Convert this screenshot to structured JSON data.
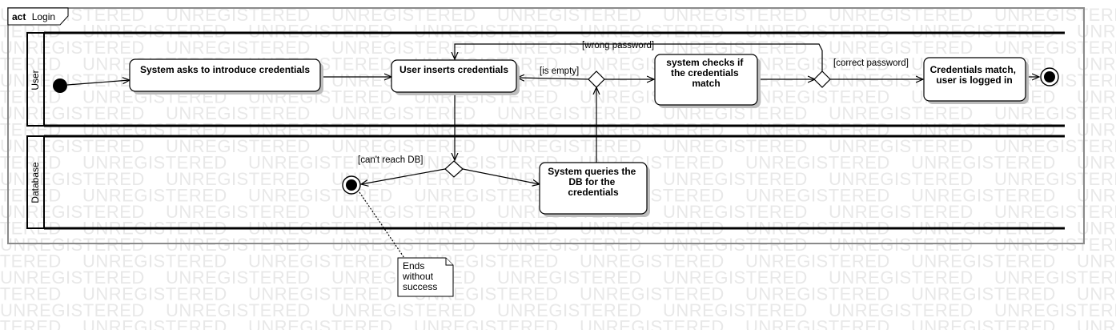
{
  "watermark": "UNREGISTERED",
  "frame": {
    "keyword": "act",
    "name": "Login"
  },
  "lanes": [
    {
      "id": "user",
      "label": "User"
    },
    {
      "id": "db",
      "label": "Database"
    }
  ],
  "actions": {
    "ask": [
      "System asks to introduce credentials"
    ],
    "insert": [
      "User inserts credentials"
    ],
    "check": [
      "system checks if",
      "the credentials",
      "match"
    ],
    "match": [
      "Credentials match,",
      "user is logged in"
    ],
    "query": [
      "System queries the",
      "DB for the",
      "credentials"
    ]
  },
  "guards": {
    "wrong": "[wrong password]",
    "correct": "[correct password]",
    "empty": "[is empty]",
    "cantreach": "[can't reach DB]"
  },
  "note": [
    "Ends",
    "without",
    "success"
  ]
}
